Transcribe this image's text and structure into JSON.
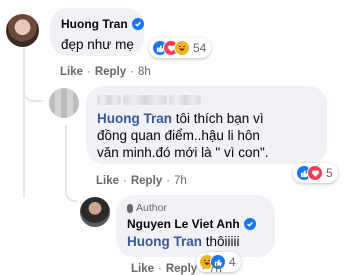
{
  "comments": [
    {
      "author": "Huong Tran",
      "verified": true,
      "text": "đẹp như mẹ",
      "reactions": {
        "icons": [
          "like-icon",
          "love-icon",
          "haha-icon"
        ],
        "count": "54"
      },
      "actions": {
        "like": "Like",
        "reply": "Reply",
        "time": "8h"
      }
    },
    {
      "author": "",
      "mention": "Huong Tran",
      "text_lines": [
        "tôi thích bạn vì",
        "đồng quan điểm..hậu li hôn",
        "văn minh.đó mới là \" vì con\"."
      ],
      "reactions": {
        "icons": [
          "like-icon",
          "love-icon"
        ],
        "count": "5"
      },
      "actions": {
        "like": "Like",
        "reply": "Reply",
        "time": "7h"
      }
    },
    {
      "badge": "Author",
      "author": "Nguyen Le Viet Anh",
      "verified": true,
      "mention": "Huong Tran",
      "text": "thôiiiii",
      "reactions": {
        "icons": [
          "haha-icon",
          "like-icon"
        ],
        "count": "4"
      },
      "actions": {
        "like": "Like",
        "reply": "Reply",
        "time": "7h"
      }
    }
  ],
  "colors": {
    "link": "#385898",
    "like": "#1877f2",
    "love": "#f33e58",
    "haha": "#f7b125",
    "meta": "#65676b"
  }
}
